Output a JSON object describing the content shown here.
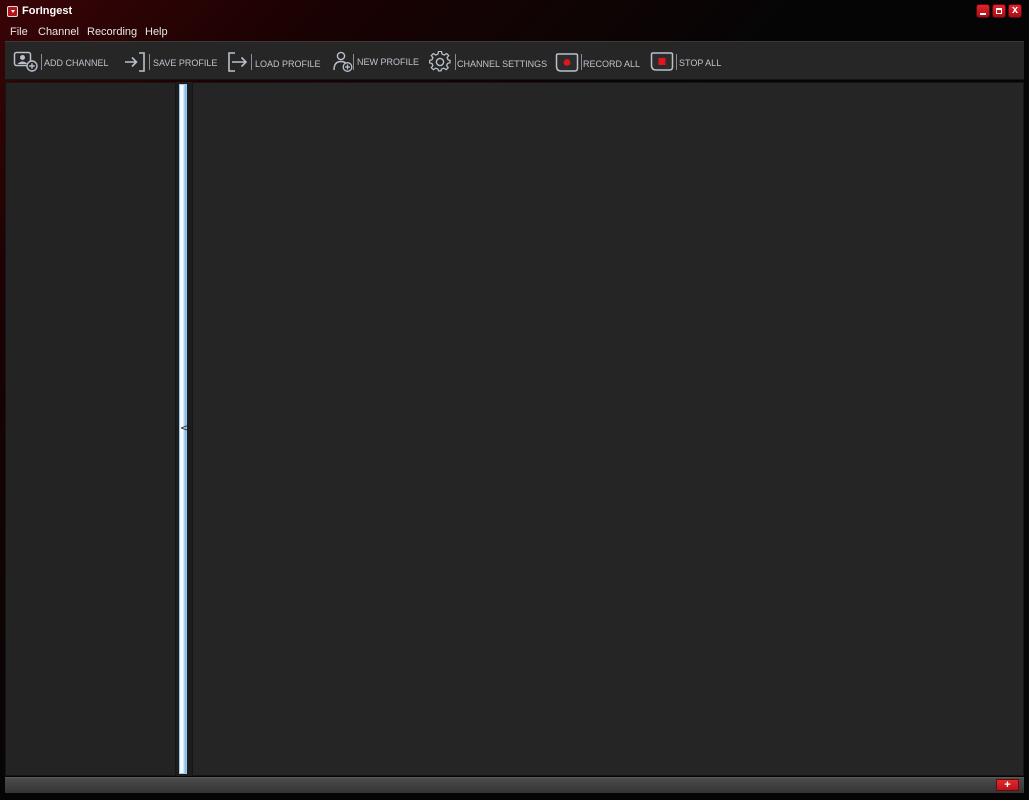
{
  "window": {
    "title": "ForIngest",
    "controls": [
      "minimize",
      "maximize",
      "close"
    ],
    "close_glyph": "x"
  },
  "menu": [
    {
      "label": "File"
    },
    {
      "label": "Channel"
    },
    {
      "label": "Recording"
    },
    {
      "label": "Help"
    }
  ],
  "toolbar": {
    "add_channel": {
      "label": "ADD CHANNEL",
      "icon": "add-channel-icon"
    },
    "save_profile": {
      "label": "SAVE PROFILE",
      "icon": "save-profile-icon"
    },
    "load_profile": {
      "label": "LOAD PROFILE",
      "icon": "load-profile-icon"
    },
    "new_profile": {
      "label": "NEW PROFILE",
      "icon": "new-profile-icon"
    },
    "channel_settings": {
      "label": "CHANNEL SETTINGS",
      "icon": "gear-icon"
    },
    "record_all": {
      "label": "RECORD ALL",
      "icon": "record-icon"
    },
    "stop_all": {
      "label": "STOP ALL",
      "icon": "stop-icon"
    }
  },
  "splitter": {
    "collapse_glyph": "<"
  },
  "statusbar": {
    "add_glyph": "+"
  },
  "colors": {
    "accent_red": "#d3141b",
    "toolbar_bg": "#262626",
    "panel_bg": "#232323",
    "splitter_blue": "#6fb0e3"
  }
}
